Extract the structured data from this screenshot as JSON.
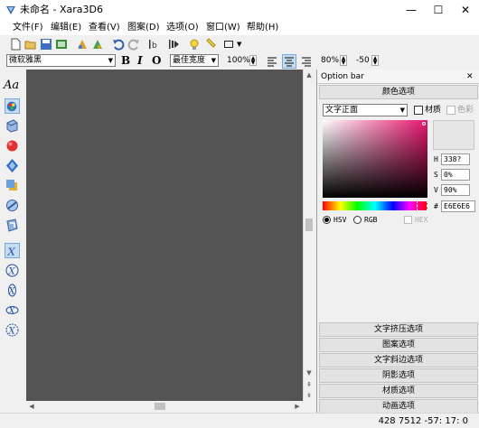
{
  "window": {
    "title": "未命名 - Xara3D6",
    "minimize": "—",
    "maximize": "☐",
    "close": "✕"
  },
  "menu": [
    "文件(F)",
    "编辑(E)",
    "查看(V)",
    "图案(D)",
    "选项(O)",
    "窗口(W)",
    "帮助(H)"
  ],
  "toolbar": {
    "font": "微软雅黑",
    "bold": "B",
    "italic": "I",
    "outline": "O",
    "quality": "最佳宽度",
    "zoom": "100%",
    "spacing": "80%",
    "offset": "-50"
  },
  "left_tools": [
    "Aa"
  ],
  "panel": {
    "title": "Option bar",
    "close": "✕",
    "color_section": "颜色选项",
    "target": "文字正面",
    "texture_label": "材质",
    "color_label": "色彩",
    "fields": {
      "h_label": "H",
      "h": "338?",
      "s_label": "S",
      "s": "0%",
      "v_label": "V",
      "v": "90%",
      "hex_label": "#",
      "hex": "E6E6E6"
    },
    "modes": {
      "hsv": "HSV",
      "rgb": "RGB",
      "hex": "HEX"
    },
    "sections": [
      "文字挤压选项",
      "图案选项",
      "文字斜边选项",
      "阴影选项",
      "材质选项",
      "动画选项"
    ]
  },
  "status": "428 7512  -57: 17: 0",
  "colors": {
    "canvas": "#545454",
    "accent_magenta": "#e8156d",
    "selected_swatch": "#e6e6e6"
  }
}
